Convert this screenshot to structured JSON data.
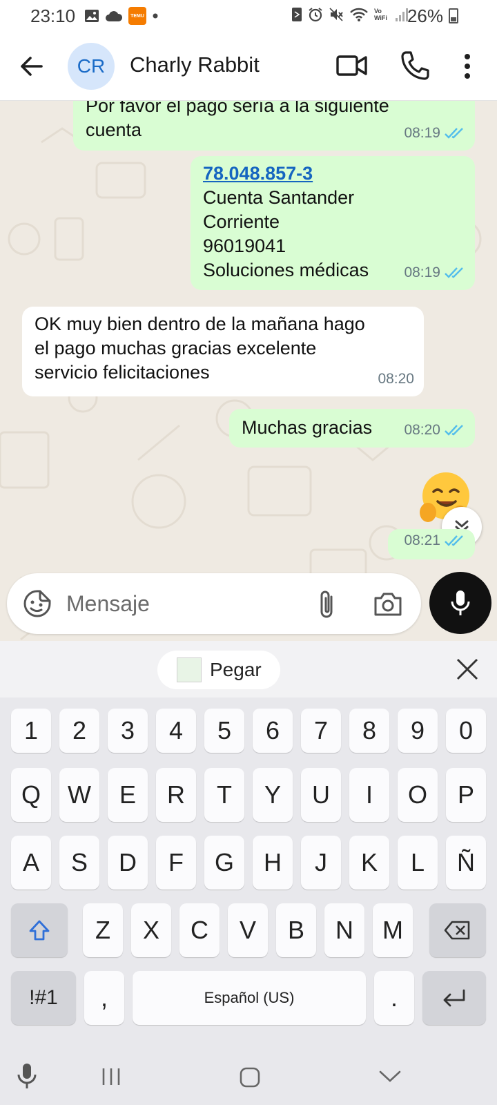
{
  "status_bar": {
    "time": "23:10",
    "temu_label": "TEMU",
    "vowifi_label": "Vo WiFi",
    "battery": "26%"
  },
  "header": {
    "avatar_initials": "CR",
    "contact_name": "Charly Rabbit"
  },
  "messages": [
    {
      "direction": "out",
      "lines": [
        "Por favor el pago sería a la siguiente",
        "cuenta"
      ],
      "time": "08:19",
      "read": true
    },
    {
      "direction": "out",
      "link": "78.048.857-3",
      "lines": [
        "Cuenta Santander",
        "Corriente",
        "96019041",
        "Soluciones médicas"
      ],
      "time": "08:19",
      "read": true
    },
    {
      "direction": "in",
      "lines": [
        "OK muy bien dentro de la mañana hago",
        "el pago muchas gracias excelente",
        "servicio felicitaciones"
      ],
      "time": "08:20"
    },
    {
      "direction": "out",
      "lines": [
        "Muchas gracias"
      ],
      "time": "08:20",
      "read": true
    },
    {
      "direction": "out",
      "emoji": "🤗",
      "time": "08:21",
      "read": true
    }
  ],
  "composer": {
    "placeholder": "Mensaje"
  },
  "clipboard": {
    "paste_label": "Pegar"
  },
  "keyboard": {
    "number_row": [
      "1",
      "2",
      "3",
      "4",
      "5",
      "6",
      "7",
      "8",
      "9",
      "0"
    ],
    "row1": [
      "Q",
      "W",
      "E",
      "R",
      "T",
      "Y",
      "U",
      "I",
      "O",
      "P"
    ],
    "row2": [
      "A",
      "S",
      "D",
      "F",
      "G",
      "H",
      "J",
      "K",
      "L",
      "Ñ"
    ],
    "row3": [
      "Z",
      "X",
      "C",
      "V",
      "B",
      "N",
      "M"
    ],
    "symbols_label": "!#1",
    "comma": ",",
    "space_label": "Español (US)",
    "period": "."
  },
  "colors": {
    "outgoing_bubble": "#d9fdd3",
    "incoming_bubble": "#ffffff",
    "read_ticks": "#53bdeb",
    "chat_background": "#efeae2",
    "link": "#1565c0"
  }
}
